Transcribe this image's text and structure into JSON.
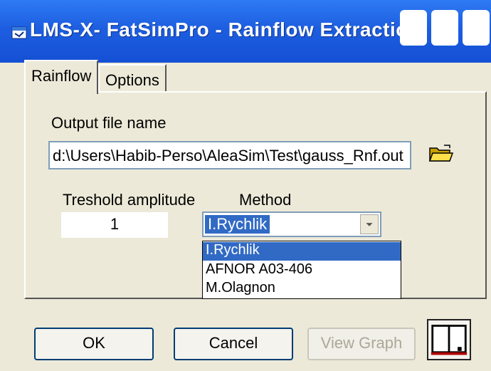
{
  "window": {
    "title": "LMS-X- FatSimPro - Rainflow Extraction"
  },
  "tabs": [
    {
      "label": "Rainflow"
    },
    {
      "label": "Options"
    }
  ],
  "form": {
    "output_label": "Output file name",
    "output_value": "d:\\Users\\Habib-Perso\\AleaSim\\Test\\gauss_Rnf.out",
    "threshold_label": "Treshold amplitude",
    "threshold_value": "1",
    "method_label": "Method",
    "method_value": "I.Rychlik",
    "method_options": [
      "I.Rychlik",
      "AFNOR A03-406",
      "M.Olagnon"
    ]
  },
  "buttons": {
    "ok": "OK",
    "cancel": "Cancel",
    "view_graph": "View Graph"
  },
  "colors": {
    "title_bar": "#1d5ee0",
    "selection": "#316ac5",
    "face": "#ece9d8"
  },
  "icons": {
    "folder": "open-folder-icon",
    "book": "book-icon",
    "title": "app-icon"
  }
}
